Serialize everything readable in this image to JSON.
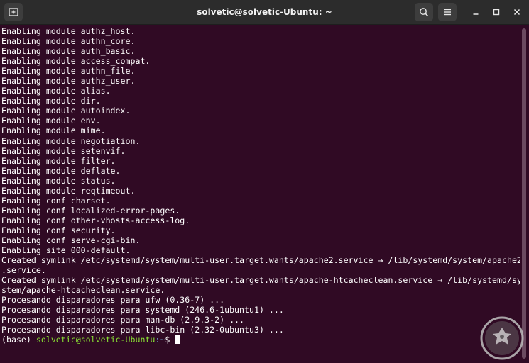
{
  "window": {
    "title": "solvetic@solvetic-Ubuntu: ~",
    "background": "#300a24",
    "titlebar_background": "#2c2c2c"
  },
  "titlebar": {
    "new_tab_icon": "new-tab-icon",
    "search_icon": "search-icon",
    "menu_icon": "hamburger-menu-icon",
    "minimize_icon": "minimize-icon",
    "maximize_icon": "maximize-icon",
    "close_icon": "close-icon"
  },
  "terminal": {
    "lines": [
      "Enabling module authz_host.",
      "Enabling module authn_core.",
      "Enabling module auth_basic.",
      "Enabling module access_compat.",
      "Enabling module authn_file.",
      "Enabling module authz_user.",
      "Enabling module alias.",
      "Enabling module dir.",
      "Enabling module autoindex.",
      "Enabling module env.",
      "Enabling module mime.",
      "Enabling module negotiation.",
      "Enabling module setenvif.",
      "Enabling module filter.",
      "Enabling module deflate.",
      "Enabling module status.",
      "Enabling module reqtimeout.",
      "Enabling conf charset.",
      "Enabling conf localized-error-pages.",
      "Enabling conf other-vhosts-access-log.",
      "Enabling conf security.",
      "Enabling conf serve-cgi-bin.",
      "Enabling site 000-default.",
      "Created symlink /etc/systemd/system/multi-user.target.wants/apache2.service → /lib/systemd/system/apache2",
      ".service.",
      "Created symlink /etc/systemd/system/multi-user.target.wants/apache-htcacheclean.service → /lib/systemd/sy",
      "stem/apache-htcacheclean.service.",
      "Procesando disparadores para ufw (0.36-7) ...",
      "Procesando disparadores para systemd (246.6-1ubuntu1) ...",
      "Procesando disparadores para man-db (2.9.3-2) ...",
      "Procesando disparadores para libc-bin (2.32-0ubuntu3) ..."
    ],
    "prompt": {
      "env": "(base) ",
      "user_host": "solvetic@solvetic-Ubuntu",
      "path": ":~",
      "symbol": "$ "
    },
    "text_color": "#ffffff",
    "prompt_user_color": "#8ae234",
    "prompt_path_color": "#729fcf"
  },
  "watermark": {
    "icon": "solvetic-logo-icon"
  }
}
